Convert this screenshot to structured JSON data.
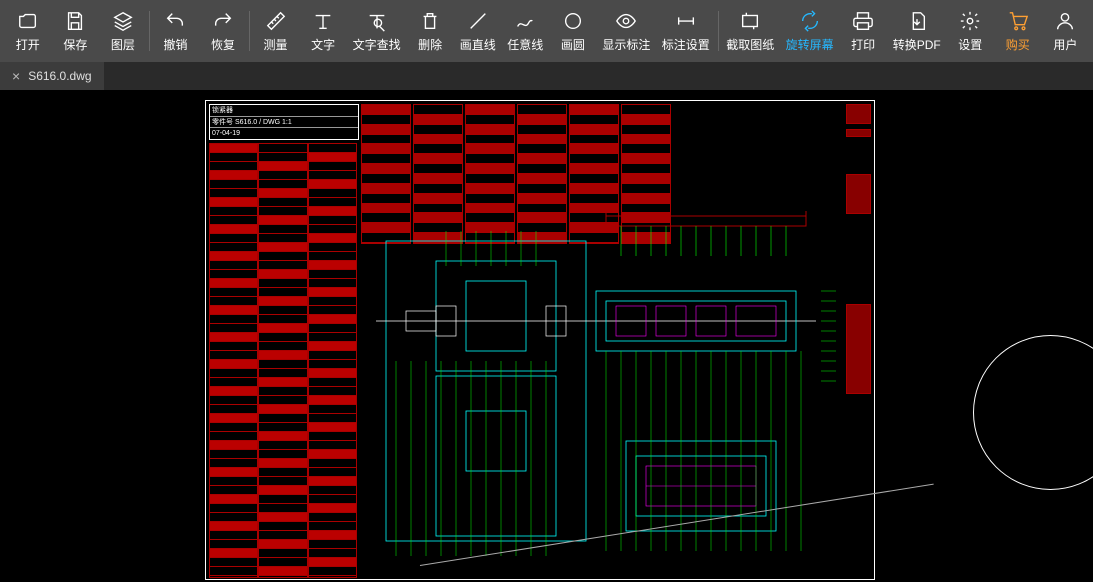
{
  "toolbar": {
    "open": "打开",
    "save": "保存",
    "layer": "图层",
    "undo": "撤销",
    "redo": "恢复",
    "measure": "测量",
    "text": "文字",
    "textfind": "文字查找",
    "delete": "删除",
    "drawline": "画直线",
    "anyline": "任意线",
    "circle": "画圆",
    "showannot": "显示标注",
    "annotset": "标注设置",
    "screenshot": "截取图纸",
    "rotate": "旋转屏幕",
    "print": "打印",
    "convertpdf": "转换PDF",
    "settings": "设置",
    "purchase": "购买",
    "user": "用户"
  },
  "tab": {
    "filename": "S616.0.dwg"
  },
  "drawing": {
    "title_row1": "锁紧器",
    "title_row2": "零件号 S616.0 / DWG 1:1",
    "title_row3": "07-04-19"
  },
  "colors": {
    "highlight": "#25b8ff",
    "orange": "#ffa033",
    "yellow": "#ffff00",
    "red": "#cc0000",
    "cyan": "#00ffff",
    "green": "#00ff00",
    "magenta": "#ff00ff"
  }
}
